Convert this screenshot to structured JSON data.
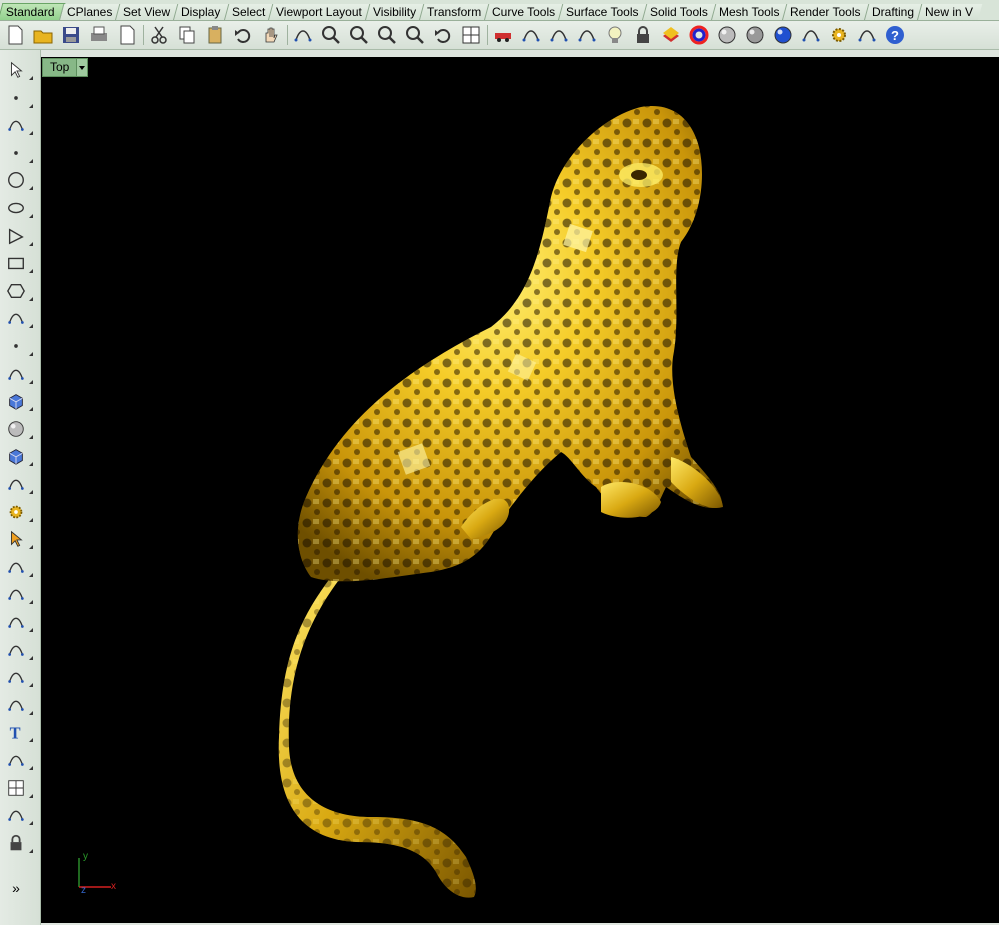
{
  "tabs": [
    "Standard",
    "CPlanes",
    "Set View",
    "Display",
    "Select",
    "Viewport Layout",
    "Visibility",
    "Transform",
    "Curve Tools",
    "Surface Tools",
    "Solid Tools",
    "Mesh Tools",
    "Render Tools",
    "Drafting",
    "New in V"
  ],
  "active_tab": "Standard",
  "toolbar_icons": [
    "new-document-icon",
    "open-folder-icon",
    "save-icon",
    "print-icon",
    "properties-icon",
    "cut-icon",
    "copy-icon",
    "paste-icon",
    "undo-icon",
    "pan-hand-icon",
    "rotate-view-icon",
    "zoom-icon",
    "zoom-window-icon",
    "zoom-extents-icon",
    "zoom-selected-icon",
    "undo-view-icon",
    "four-viewports-icon",
    "car-icon",
    "cplane-icon",
    "grid-snap-icon",
    "osnap-icon",
    "light-bulb-icon",
    "lock-icon",
    "layer-icon",
    "color-wheel-icon",
    "render-sphere-icon",
    "shaded-sphere-icon",
    "render-blue-sphere-icon",
    "properties-pen-icon",
    "settings-gear-icon",
    "dimension-icon",
    "help-icon"
  ],
  "left_tools": [
    "select-arrow-icon",
    "point-icon",
    "polyline-icon",
    "curve-points-icon",
    "circle-icon",
    "ellipse-icon",
    "polygon-triangle-icon",
    "rectangle-icon",
    "hexagon-icon",
    "curve-fillet-icon",
    "surface-points-icon",
    "extrude-surface-icon",
    "box-solid-icon",
    "boolean-spheres-icon",
    "cylinder-icon",
    "mesh-plane-icon",
    "gear-solid-icon",
    "edit-arrow-icon",
    "move-tool-icon",
    "align-tool-icon",
    "group-icon",
    "array-icon",
    "curve-arc-icon",
    "blend-curve-icon",
    "text-icon",
    "scale-icon",
    "array-grid-icon",
    "transform-icon",
    "block-icon",
    "more-tools-icon"
  ],
  "viewport": {
    "name": "Top",
    "axis_y": "y",
    "axis_x": "x",
    "axis_z": "z",
    "more_label": "»"
  },
  "colors": {
    "viewport_bg": "#000000",
    "gold_light": "#f7d23a",
    "gold_mid": "#d4a810",
    "gold_dark": "#6e4f00",
    "axis_x": "#d42020",
    "axis_y": "#2a8a2a"
  }
}
